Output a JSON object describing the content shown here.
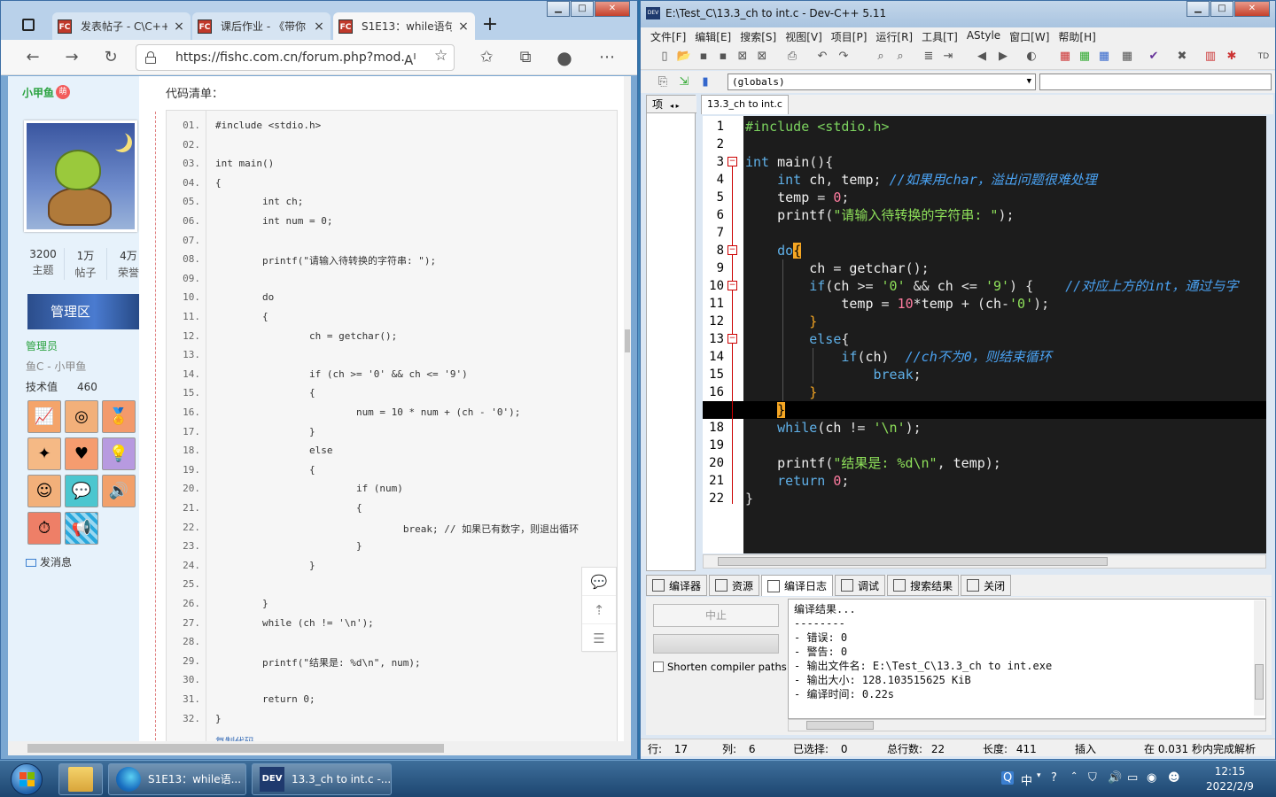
{
  "browser": {
    "tabs": [
      {
        "label": "发表帖子 - C\\C++",
        "icon": "FC"
      },
      {
        "label": "课后作业 - 《带你",
        "icon": "FC"
      },
      {
        "label": "S1E13：while语句",
        "icon": "FC"
      }
    ],
    "url": "https://fishc.com.cn/forum.php?mod...",
    "sidebar": {
      "username": "小甲鱼",
      "badge": "萌",
      "stats": [
        {
          "value": "3200",
          "label": "主题"
        },
        {
          "value": "1万",
          "label": "帖子"
        },
        {
          "value": "4万",
          "label": "荣誉"
        }
      ],
      "mgr_badge": "管理区",
      "role": "管理员",
      "group": "鱼C - 小甲鱼",
      "tech_label": "技术值",
      "tech_value": "460",
      "send_msg": "发消息"
    },
    "code_title": "代码清单：",
    "code_lines": [
      {
        "n": "01.",
        "t": "#include <stdio.h>"
      },
      {
        "n": "02.",
        "t": ""
      },
      {
        "n": "03.",
        "t": "int main()"
      },
      {
        "n": "04.",
        "t": "{"
      },
      {
        "n": "05.",
        "t": "        int ch;"
      },
      {
        "n": "06.",
        "t": "        int num = 0;"
      },
      {
        "n": "07.",
        "t": ""
      },
      {
        "n": "08.",
        "t": "        printf(\"请输入待转换的字符串: \");"
      },
      {
        "n": "09.",
        "t": ""
      },
      {
        "n": "10.",
        "t": "        do"
      },
      {
        "n": "11.",
        "t": "        {"
      },
      {
        "n": "12.",
        "t": "                ch = getchar();"
      },
      {
        "n": "13.",
        "t": ""
      },
      {
        "n": "14.",
        "t": "                if (ch >= '0' && ch <= '9')"
      },
      {
        "n": "15.",
        "t": "                {"
      },
      {
        "n": "16.",
        "t": "                        num = 10 * num + (ch - '0');"
      },
      {
        "n": "17.",
        "t": "                }"
      },
      {
        "n": "18.",
        "t": "                else"
      },
      {
        "n": "19.",
        "t": "                {"
      },
      {
        "n": "20.",
        "t": "                        if (num)"
      },
      {
        "n": "21.",
        "t": "                        {"
      },
      {
        "n": "22.",
        "t": "                                break; // 如果已有数字，则退出循环"
      },
      {
        "n": "23.",
        "t": "                        }"
      },
      {
        "n": "24.",
        "t": "                }"
      },
      {
        "n": "25.",
        "t": ""
      },
      {
        "n": "26.",
        "t": "        }"
      },
      {
        "n": "27.",
        "t": "        while (ch != '\\n');"
      },
      {
        "n": "28.",
        "t": ""
      },
      {
        "n": "29.",
        "t": "        printf(\"结果是: %d\\n\", num);"
      },
      {
        "n": "30.",
        "t": ""
      },
      {
        "n": "31.",
        "t": "        return 0;"
      },
      {
        "n": "32.",
        "t": "}"
      }
    ],
    "copy_code": "复制代码"
  },
  "devcpp": {
    "title": "E:\\Test_C\\13.3_ch to int.c - Dev-C++ 5.11",
    "menu": [
      "文件[F]",
      "编辑[E]",
      "搜索[S]",
      "视图[V]",
      "项目[P]",
      "运行[R]",
      "工具[T]",
      "AStyle",
      "窗口[W]",
      "帮助[H]"
    ],
    "globals": "(globals)",
    "project_tab": "项",
    "file_tab": "13.3_ch to int.c",
    "bottom_tabs": [
      "编译器",
      "资源",
      "编译日志",
      "调试",
      "搜索结果",
      "关闭"
    ],
    "stop_button": "中止",
    "shorten_paths": "Shorten compiler paths",
    "log": [
      "编译结果...",
      "--------",
      "- 错误: 0",
      "- 警告: 0",
      "- 输出文件名: E:\\Test_C\\13.3_ch to int.exe",
      "- 输出大小: 128.103515625 KiB",
      "- 编译时间: 0.22s"
    ],
    "status": {
      "row_label": "行:",
      "row": "17",
      "col_label": "列:",
      "col": "6",
      "sel_label": "已选择:",
      "sel": "0",
      "lines_label": "总行数:",
      "lines": "22",
      "len_label": "长度:",
      "len": "411",
      "mode": "插入",
      "parse": "在 0.031 秒内完成解析"
    }
  },
  "taskbar": {
    "items": [
      "S1E13：while语...",
      "13.3_ch to int.c -..."
    ],
    "ime": "中",
    "time": "12:15",
    "date": "2022/2/9"
  }
}
